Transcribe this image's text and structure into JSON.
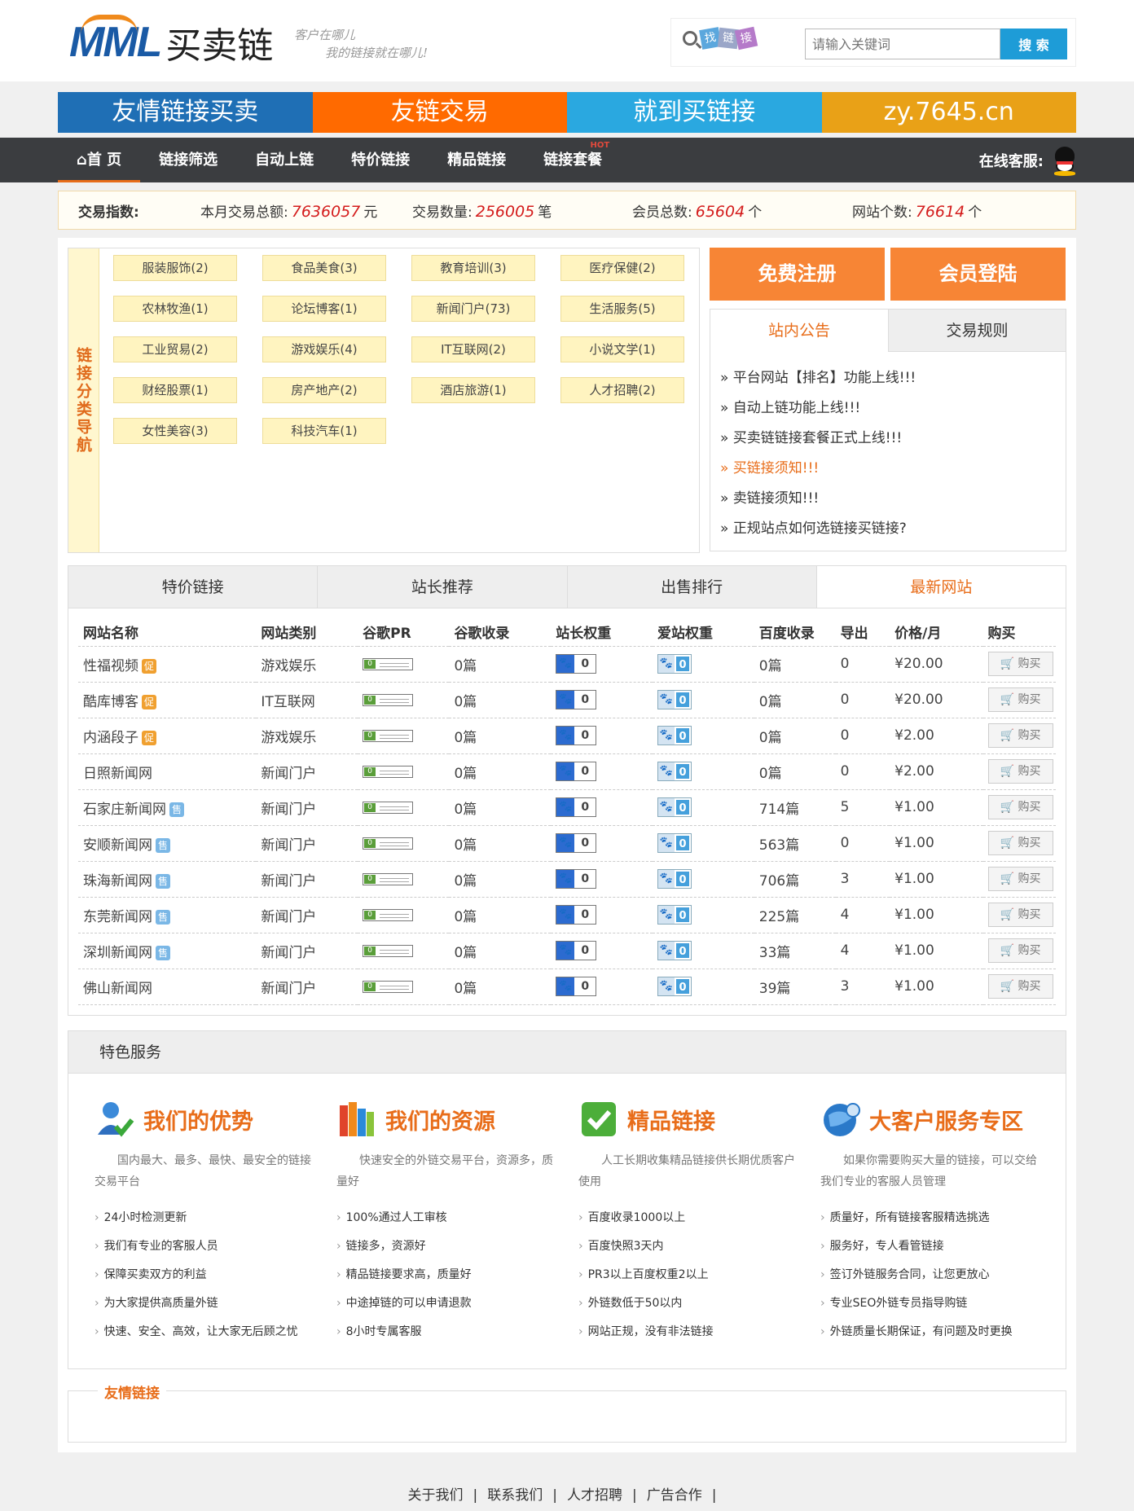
{
  "brand": {
    "logo_latin": "MML",
    "logo_cn": "买卖链",
    "slogan_1": "客户在哪儿",
    "slogan_2": "我的链接就在哪儿!"
  },
  "search": {
    "chip_1": "找",
    "chip_2": "链",
    "chip_3": "接",
    "placeholder": "请输入关键词",
    "button": "搜 索"
  },
  "banner": [
    "友情链接买卖",
    "友链交易",
    "就到买链接",
    "zy.7645.cn"
  ],
  "nav": {
    "items": [
      "首 页",
      "链接筛选",
      "自动上链",
      "特价链接",
      "精品链接",
      "链接套餐"
    ],
    "hot": "HOT",
    "kefu": "在线客服:"
  },
  "stats": {
    "label": "交易指数:",
    "items": [
      {
        "label": "本月交易总额:",
        "value": "7636057",
        "unit": "元"
      },
      {
        "label": "交易数量:",
        "value": "256005",
        "unit": "笔"
      },
      {
        "label": "会员总数:",
        "value": "65604",
        "unit": "个"
      },
      {
        "label": "网站个数:",
        "value": "76614",
        "unit": "个"
      }
    ]
  },
  "categories": {
    "label": "链接分类导航",
    "items": [
      "服装服饰(2)",
      "食品美食(3)",
      "教育培训(3)",
      "医疗保健(2)",
      "农林牧渔(1)",
      "论坛博客(1)",
      "新闻门户(73)",
      "生活服务(5)",
      "工业贸易(2)",
      "游戏娱乐(4)",
      "IT互联网(2)",
      "小说文学(1)",
      "财经股票(1)",
      "房产地产(2)",
      "酒店旅游(1)",
      "人才招聘(2)",
      "女性美容(3)",
      "科技汽车(1)"
    ]
  },
  "auth": {
    "register": "免费注册",
    "login": "会员登陆"
  },
  "notice": {
    "tabs": [
      "站内公告",
      "交易规则"
    ],
    "items": [
      "» 平台网站【排名】功能上线!!!",
      "» 自动上链功能上线!!!",
      "» 买卖链链接套餐正式上线!!!",
      "» 买链接须知!!!",
      "» 卖链接须知!!!",
      "» 正规站点如何选链接买链接?"
    ]
  },
  "sites": {
    "tabs": [
      "特价链接",
      "站长推荐",
      "出售排行",
      "最新网站"
    ],
    "headers": [
      "网站名称",
      "网站类别",
      "谷歌PR",
      "谷歌收录",
      "站长权重",
      "爱站权重",
      "百度收录",
      "导出",
      "价格/月",
      "购买"
    ],
    "tag_cu": "促",
    "tag_shou": "售",
    "pr_value": "0",
    "buy_label": "购买",
    "cart_icon": "cart-icon",
    "rows": [
      {
        "name": "性福视频",
        "tag": "促",
        "cat": "游戏娱乐",
        "gsl": "0篇",
        "zz": "0",
        "az": "0",
        "bd": "0篇",
        "out": "0",
        "price": "¥20.00"
      },
      {
        "name": "酷库博客",
        "tag": "促",
        "cat": "IT互联网",
        "gsl": "0篇",
        "zz": "0",
        "az": "0",
        "bd": "0篇",
        "out": "0",
        "price": "¥20.00"
      },
      {
        "name": "内涵段子",
        "tag": "促",
        "cat": "游戏娱乐",
        "gsl": "0篇",
        "zz": "0",
        "az": "0",
        "bd": "0篇",
        "out": "0",
        "price": "¥2.00"
      },
      {
        "name": "日照新闻网",
        "tag": "",
        "cat": "新闻门户",
        "gsl": "0篇",
        "zz": "0",
        "az": "0",
        "bd": "0篇",
        "out": "0",
        "price": "¥2.00"
      },
      {
        "name": "石家庄新闻网",
        "tag": "售",
        "cat": "新闻门户",
        "gsl": "0篇",
        "zz": "0",
        "az": "0",
        "bd": "714篇",
        "out": "5",
        "price": "¥1.00"
      },
      {
        "name": "安顺新闻网",
        "tag": "售",
        "cat": "新闻门户",
        "gsl": "0篇",
        "zz": "0",
        "az": "0",
        "bd": "563篇",
        "out": "0",
        "price": "¥1.00"
      },
      {
        "name": "珠海新闻网",
        "tag": "售",
        "cat": "新闻门户",
        "gsl": "0篇",
        "zz": "0",
        "az": "0",
        "bd": "706篇",
        "out": "3",
        "price": "¥1.00"
      },
      {
        "name": "东莞新闻网",
        "tag": "售",
        "cat": "新闻门户",
        "gsl": "0篇",
        "zz": "0",
        "az": "0",
        "bd": "225篇",
        "out": "4",
        "price": "¥1.00"
      },
      {
        "name": "深圳新闻网",
        "tag": "售",
        "cat": "新闻门户",
        "gsl": "0篇",
        "zz": "0",
        "az": "0",
        "bd": "33篇",
        "out": "4",
        "price": "¥1.00"
      },
      {
        "name": "佛山新闻网",
        "tag": "",
        "cat": "新闻门户",
        "gsl": "0篇",
        "zz": "0",
        "az": "0",
        "bd": "39篇",
        "out": "3",
        "price": "¥1.00"
      }
    ]
  },
  "services": {
    "title": "特色服务",
    "cols": [
      {
        "icon": "user-check-icon",
        "title": "我们的优势",
        "desc": "国内最大、最多、最快、最安全的链接交易平台",
        "items": [
          "24小时检测更新",
          "我们有专业的客服人员",
          "保障买卖双方的利益",
          "为大家提供高质量外链",
          "快速、安全、高效，让大家无后顾之忧"
        ]
      },
      {
        "icon": "books-icon",
        "title": "我们的资源",
        "desc": "快速安全的外链交易平台，资源多，质量好",
        "items": [
          "100%通过人工审核",
          "链接多，资源好",
          "精品链接要求高，质量好",
          "中途掉链的可以申请退款",
          "8小时专属客服"
        ]
      },
      {
        "icon": "checkmark-icon",
        "title": "精品链接",
        "desc": "人工长期收集精品链接供长期优质客户使用",
        "items": [
          "百度收录1000以上",
          "百度快照3天内",
          "PR3以上百度权重2以上",
          "外链数低于50以内",
          "网站正规，没有非法链接"
        ]
      },
      {
        "icon": "globe-icon",
        "title": "大客户服务专区",
        "desc": "如果你需要购买大量的链接，可以交给我们专业的客服人员管理",
        "items": [
          "质量好，所有链接客服精选挑选",
          "服务好，专人看管链接",
          "签订外链服务合同，让您更放心",
          "专业SEO外链专员指导购链",
          "外链质量长期保证，有问题及时更换"
        ]
      }
    ]
  },
  "links": {
    "title": "友情链接"
  },
  "footer": [
    "关于我们",
    "联系我们",
    "人才招聘",
    "广告合作"
  ],
  "colors": {
    "accent": "#e86d1a",
    "blue": "#1e9cd7",
    "nav_bg": "#3b3d40"
  }
}
